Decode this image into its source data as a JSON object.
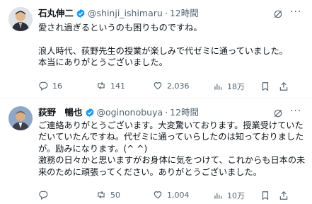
{
  "tweets": [
    {
      "name": "石丸伸二",
      "handle": "@shinji_ishimaru",
      "dot": "·",
      "time": "12時間",
      "more": "···",
      "text": "愛され過ぎるというのも困りものですね。\n\n浪人時代、荻野先生の授業が楽しみで代ゼミに通っていました。\n本当にありがとうございました。",
      "replies": "16",
      "retweets": "141",
      "likes": "2,036",
      "views": "18万",
      "icons": [
        "avatar-photo",
        "verified-badge",
        "grok-icon",
        "more-icon",
        "reply-icon",
        "retweet-icon",
        "like-icon",
        "views-icon",
        "bookmark-icon",
        "share-icon"
      ],
      "badge_color": "#1d9bf0"
    },
    {
      "name": "荻野　暢也",
      "handle": "@oginonobuya",
      "dot": "·",
      "time": "12時間",
      "more": "···",
      "text": "ご連絡ありがとうございます。大変驚いております。授業受けていただいていたんですね。代ゼミに通っていらしたのは知っておりましたが。励みになります。(^ ^)\n激務の日々かと思いますがお身体に気をつけて、これからも日本の未来のために頑張ってください。ありがとうございました。",
      "replies": "",
      "retweets": "50",
      "likes": "1,004",
      "views": "10万",
      "icons": [
        "avatar-photo",
        "verified-badge",
        "grok-icon",
        "more-icon",
        "reply-icon",
        "retweet-icon",
        "like-icon",
        "views-icon",
        "bookmark-icon",
        "share-icon"
      ],
      "badge_color": "#1d9bf0"
    }
  ],
  "colors": {
    "text": "#0f1419",
    "muted": "#536471",
    "accent": "#1d9bf0",
    "thread_line": "#cfd9de"
  }
}
